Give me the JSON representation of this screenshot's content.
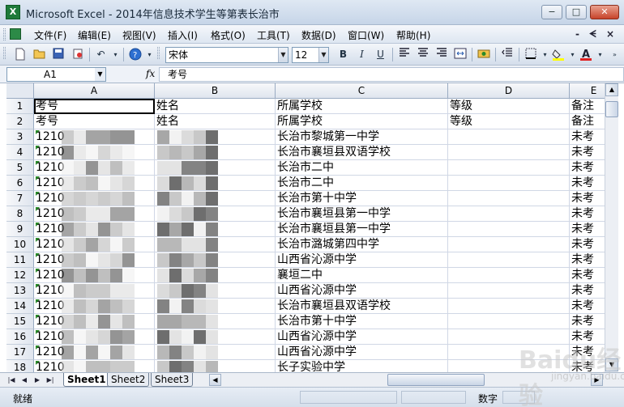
{
  "window": {
    "title": "Microsoft Excel - 2014年信息技术学生等第表长治市",
    "minimize": "−",
    "maximize": "□",
    "close": "✕"
  },
  "menu": {
    "items": [
      "文件(F)",
      "编辑(E)",
      "视图(V)",
      "插入(I)",
      "格式(O)",
      "工具(T)",
      "数据(D)",
      "窗口(W)",
      "帮助(H)"
    ],
    "doc_controls": [
      "-",
      "ᗕ",
      "×"
    ]
  },
  "toolbar": {
    "font_name": "宋体",
    "font_size": "12",
    "bold": "B",
    "italic": "I",
    "underline": "U"
  },
  "formula_bar": {
    "name_box": "A1",
    "fx": "fx",
    "content": "考号"
  },
  "grid": {
    "columns": [
      "A",
      "B",
      "C",
      "D",
      "E"
    ],
    "rows": [
      {
        "num": "1",
        "a": "考号",
        "b": "姓名",
        "c": "所属学校",
        "d": "等级",
        "e": "备注"
      },
      {
        "num": "2",
        "a": "考号",
        "b": "姓名",
        "c": "所属学校",
        "d": "等级",
        "e": "备注"
      },
      {
        "num": "3",
        "a": "1210",
        "b": "",
        "c": "长治市黎城第一中学",
        "d": "",
        "e": "未考"
      },
      {
        "num": "4",
        "a": "1210",
        "b": "",
        "c": "长治市襄垣县双语学校",
        "d": "",
        "e": "未考"
      },
      {
        "num": "5",
        "a": "1210",
        "b": "",
        "c": "长治市二中",
        "d": "",
        "e": "未考"
      },
      {
        "num": "6",
        "a": "1210",
        "b": "",
        "c": "长治市二中",
        "d": "",
        "e": "未考"
      },
      {
        "num": "7",
        "a": "1210",
        "b": "",
        "c": "长治市第十中学",
        "d": "",
        "e": "未考"
      },
      {
        "num": "8",
        "a": "1210",
        "b": "",
        "c": "长治市襄垣县第一中学",
        "d": "",
        "e": "未考"
      },
      {
        "num": "9",
        "a": "1210",
        "b": "",
        "c": "长治市襄垣县第一中学",
        "d": "",
        "e": "未考"
      },
      {
        "num": "10",
        "a": "1210",
        "b": "",
        "c": "长治市潞城第四中学",
        "d": "",
        "e": "未考"
      },
      {
        "num": "11",
        "a": "1210",
        "b": "",
        "c": "山西省沁源中学",
        "d": "",
        "e": "未考"
      },
      {
        "num": "12",
        "a": "1210",
        "b": "",
        "c": "襄垣二中",
        "d": "",
        "e": "未考"
      },
      {
        "num": "13",
        "a": "1210",
        "b": "",
        "c": "山西省沁源中学",
        "d": "",
        "e": "未考"
      },
      {
        "num": "14",
        "a": "1210",
        "b": "",
        "c": "长治市襄垣县双语学校",
        "d": "",
        "e": "未考"
      },
      {
        "num": "15",
        "a": "1210",
        "b": "",
        "c": "长治市第十中学",
        "d": "",
        "e": "未考"
      },
      {
        "num": "16",
        "a": "1210",
        "b": "",
        "c": "山西省沁源中学",
        "d": "",
        "e": "未考"
      },
      {
        "num": "17",
        "a": "1210",
        "b": "",
        "c": "山西省沁源中学",
        "d": "",
        "e": "未考"
      },
      {
        "num": "18",
        "a": "1210",
        "b": "",
        "c": "长子实验中学",
        "d": "",
        "e": "未考"
      }
    ]
  },
  "sheet_tabs": [
    "Sheet1",
    "Sheet2",
    "Sheet3"
  ],
  "status": {
    "ready": "就绪",
    "mode": "数字"
  },
  "watermark": {
    "logo": "Baidu经验",
    "sub": "jingyan.baidu.com"
  }
}
